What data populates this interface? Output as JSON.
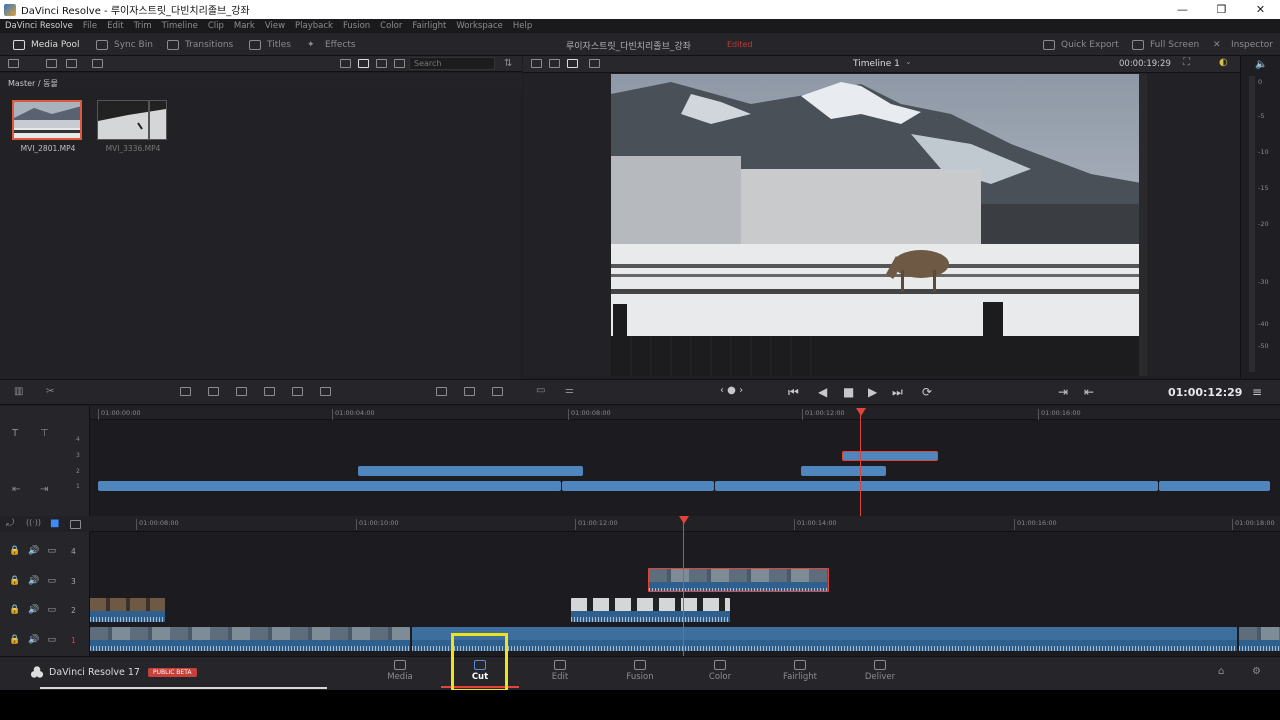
{
  "window": {
    "title": "DaVinci Resolve - 루이자스트릿_다빈치리졸브_강좌",
    "min": "—",
    "max": "❐",
    "close": "✕"
  },
  "menu": [
    "DaVinci Resolve",
    "File",
    "Edit",
    "Trim",
    "Timeline",
    "Clip",
    "Mark",
    "View",
    "Playback",
    "Fusion",
    "Color",
    "Fairlight",
    "Workspace",
    "Help"
  ],
  "toolbar": {
    "media_pool": "Media Pool",
    "sync_bin": "Sync Bin",
    "transitions": "Transitions",
    "titles": "Titles",
    "effects": "Effects",
    "project_title": "루이자스트릿_다빈치리졸브_강좌",
    "edited": "Edited",
    "quick_export": "Quick Export",
    "full_screen": "Full Screen",
    "inspector": "Inspector"
  },
  "media_pool": {
    "search_placeholder": "Search",
    "path": "Master / 동물",
    "clips": [
      {
        "name": "MVI_2801.MP4",
        "selected": true
      },
      {
        "name": "MVI_3336.MP4",
        "selected": false
      }
    ]
  },
  "viewer": {
    "timeline_name": "Timeline 1",
    "duration_tc": "00:00:19:29",
    "current_tc": "01:00:12:29"
  },
  "meter": {
    "labels": [
      "0",
      "-5",
      "-10",
      "-15",
      "-20",
      "-30",
      "-40",
      "-50"
    ]
  },
  "upper_timeline": {
    "ticks": [
      "01:00:00:00",
      "01:00:04:00",
      "01:00:08:00",
      "01:00:12:00",
      "01:00:16:00"
    ],
    "track_numbers": [
      "4",
      "3",
      "2",
      "1"
    ]
  },
  "lower_timeline": {
    "ticks": [
      "01:00:08:00",
      "01:00:10:00",
      "01:00:12:00",
      "01:00:14:00",
      "01:00:16:00",
      "01:00:18:00"
    ],
    "tracks": [
      "4",
      "3",
      "2",
      "1"
    ]
  },
  "nav": {
    "brand": "DaVinci Resolve 17",
    "beta": "PUBLIC BETA",
    "pages": [
      "Media",
      "Cut",
      "Edit",
      "Fusion",
      "Color",
      "Fairlight",
      "Deliver"
    ],
    "active_page": "Cut"
  },
  "colors": {
    "accent_red": "#e0443a",
    "clip_blue": "#4f86bd",
    "highlight_yellow": "#f2e21c"
  }
}
